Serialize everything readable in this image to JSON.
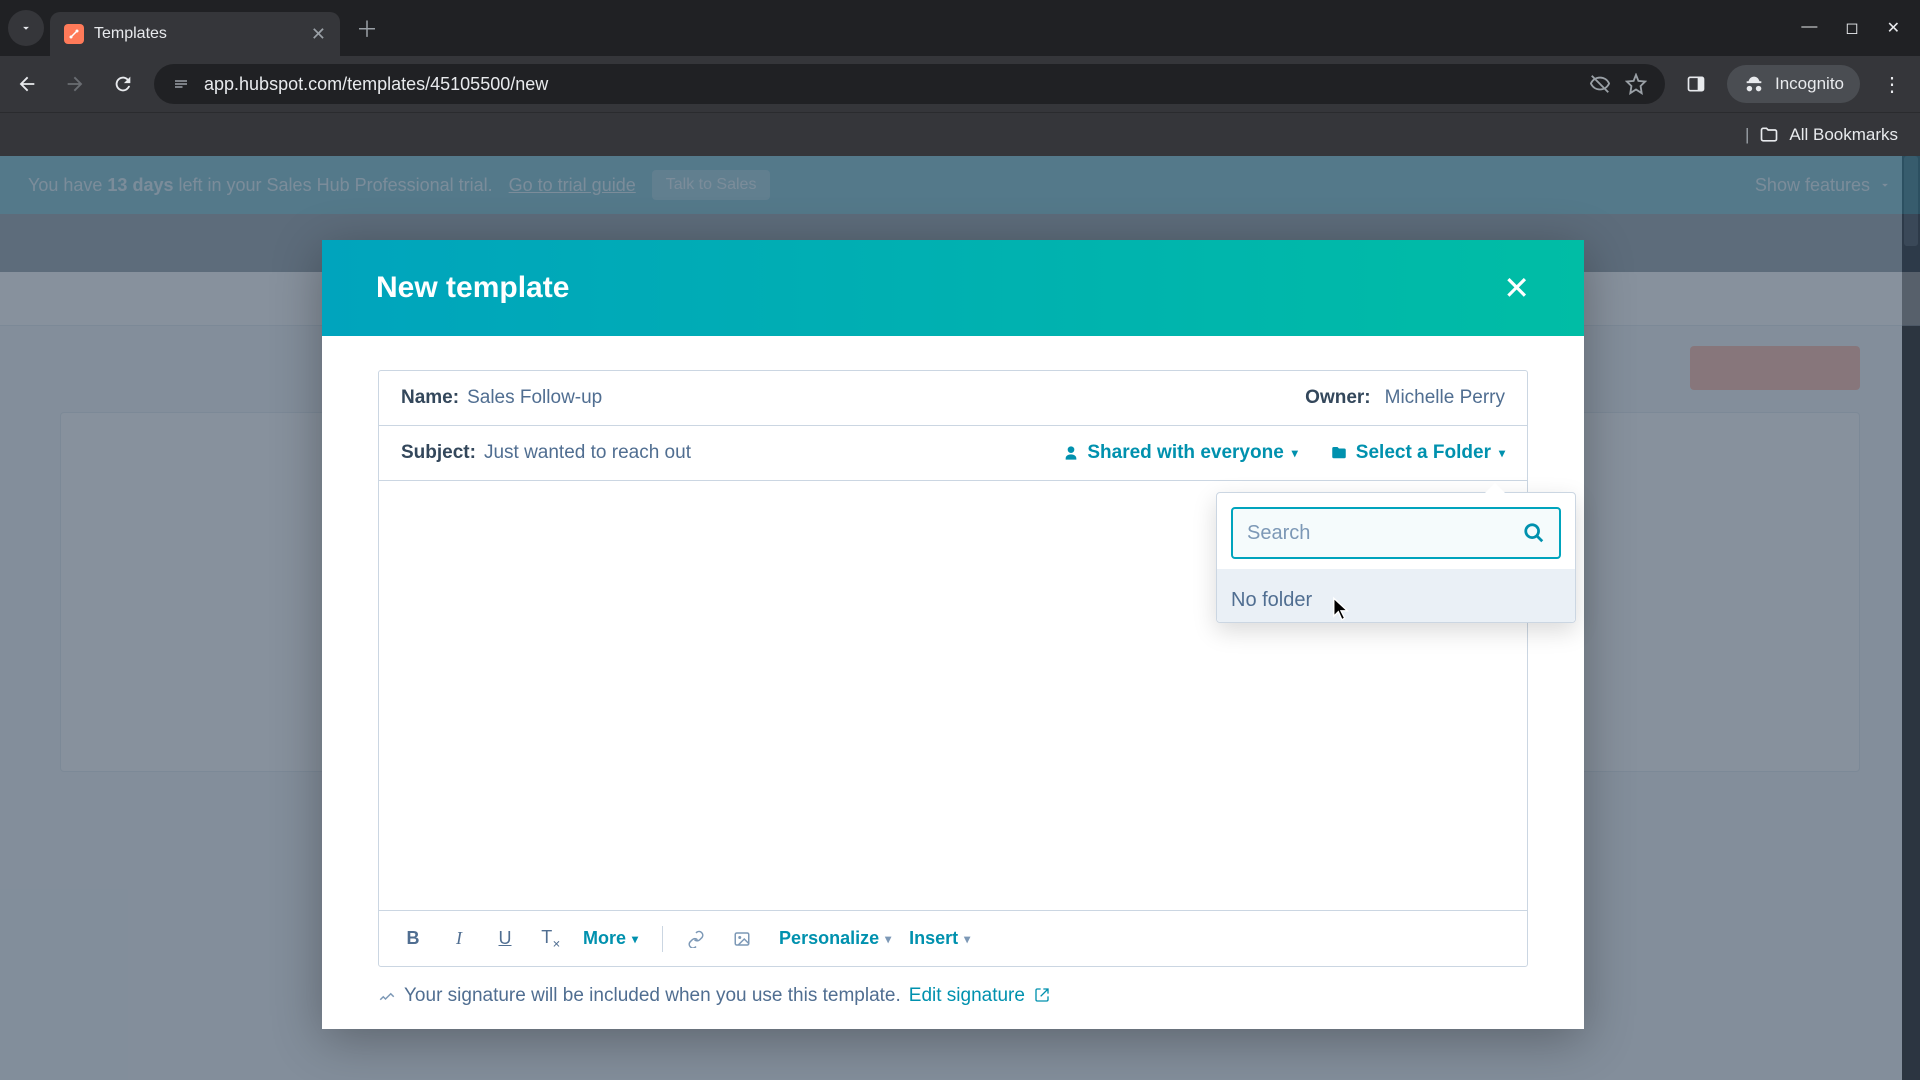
{
  "browser": {
    "tab_title": "Templates",
    "url": "app.hubspot.com/templates/45105500/new",
    "incognito_label": "Incognito",
    "all_bookmarks": "All Bookmarks"
  },
  "banner": {
    "text_prefix": "You have ",
    "days": "13 days",
    "text_suffix": " left in your Sales Hub Professional trial.",
    "guide_link": "Go to trial guide",
    "talk_btn": "Talk to Sales",
    "show_features": "Show features"
  },
  "modal": {
    "title": "New template",
    "name_label": "Name:",
    "name_value": "Sales Follow-up",
    "owner_label": "Owner:",
    "owner_value": "Michelle Perry",
    "subject_label": "Subject:",
    "subject_value": "Just wanted to reach out",
    "shared_label": "Shared with everyone",
    "folder_label": "Select a Folder",
    "toolbar": {
      "bold": "B",
      "italic": "I",
      "underline": "U",
      "clear": "T",
      "more": "More",
      "personalize": "Personalize",
      "insert": "Insert"
    },
    "signature_text": "Your signature will be included when you use this template.",
    "signature_link": "Edit signature"
  },
  "popover": {
    "search_placeholder": "Search",
    "no_folder": "No folder"
  }
}
